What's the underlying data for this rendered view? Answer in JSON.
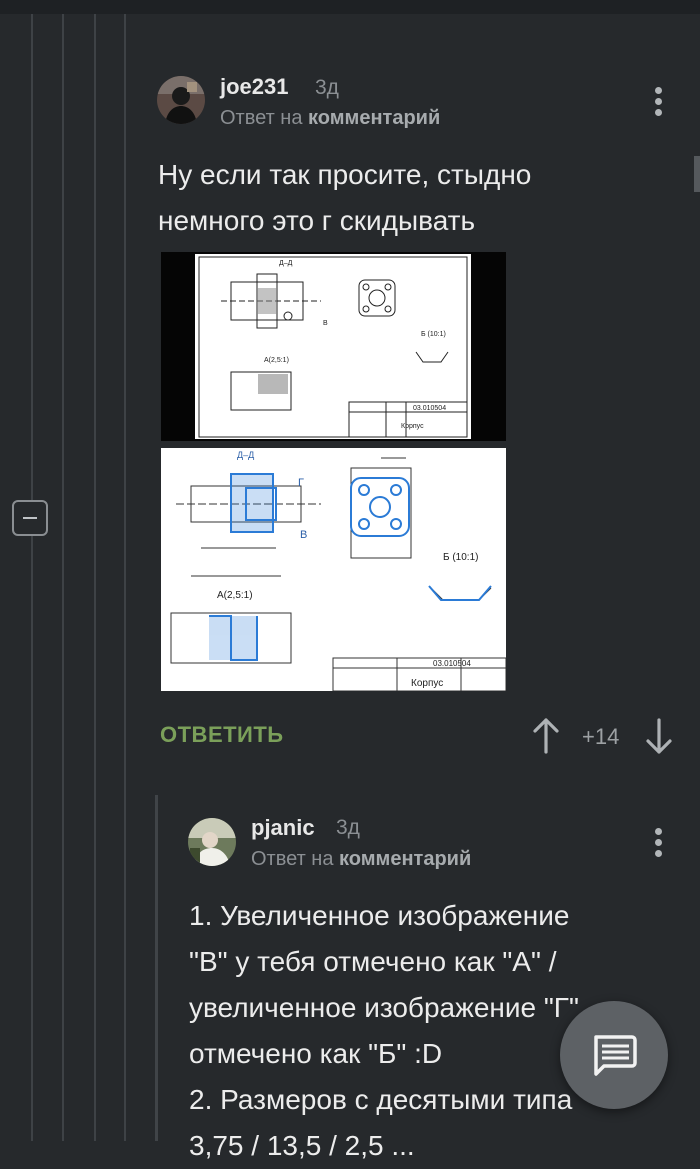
{
  "comments": [
    {
      "username": "joe231",
      "time": "3д",
      "reply_prefix": "Ответ на",
      "reply_target": "комментарий",
      "text_lines": [
        "Ну если так просите, стыдно",
        "немного это г скидывать"
      ],
      "images": [
        {
          "labels": {
            "section": "Д–Д",
            "view": "А(2,5:1)",
            "detail": "Б (10:1)",
            "title_code": "03.010504",
            "title_name": "Корпус",
            "b": "В"
          }
        },
        {
          "labels": {
            "section": "Д–Д",
            "view": "А(2,5:1)",
            "detail": "Б (10:1)",
            "title_code": "03.010504",
            "title_name": "Корпус",
            "b": "В",
            "g": "Г"
          }
        }
      ],
      "actions": {
        "reply_label": "ОТВЕТИТЬ",
        "score": "+14"
      }
    },
    {
      "username": "pjanic",
      "time": "3д",
      "reply_prefix": "Ответ на",
      "reply_target": "комментарий",
      "text_lines": [
        "1. Увеличенное изображение",
        "\"В\" у тебя отмечено как \"А\" /",
        "увеличенное изображение \"Г\"",
        "отмечено как \"Б\" :D",
        "2. Размеров с десятыми типа",
        "3,75 / 13,5 / 2,5 ..."
      ]
    }
  ],
  "colors": {
    "background": "#26292c",
    "accent_reply": "#7ba05a",
    "muted": "#8b8f93",
    "blueprint_blue": "#2b7bd6"
  },
  "icons": [
    "collapse-thread-icon",
    "more-vertical-icon",
    "arrow-up-icon",
    "arrow-down-icon",
    "comment-icon"
  ]
}
